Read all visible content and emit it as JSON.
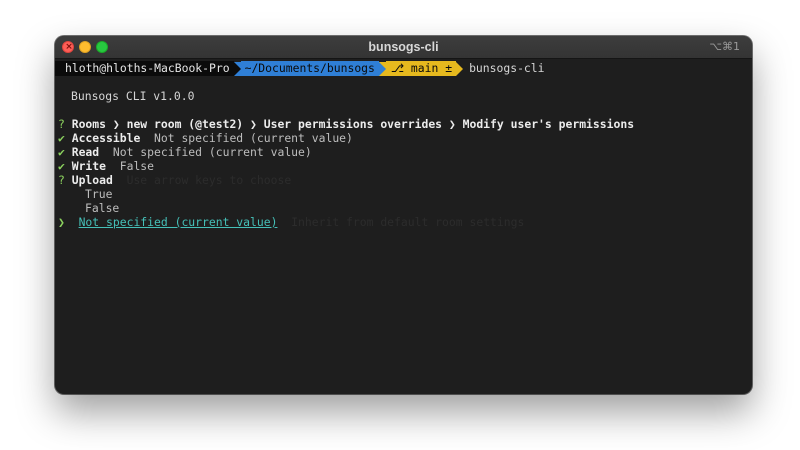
{
  "window": {
    "title": "bunsogs-cli",
    "shortcut": "⌥⌘1"
  },
  "prompt": {
    "user_host": "hloth@hloths-MacBook-Pro",
    "directory": "~/Documents/bunsogs",
    "branch_icon": "git-branch-icon",
    "branch": "main ±",
    "command": "bunsogs-cli"
  },
  "banner": "Bunsogs CLI v1.0.0",
  "breadcrumb": {
    "marker": "?",
    "text": "Rooms ❯ new room (@test2) ❯ User permissions overrides ❯ Modify user's permissions"
  },
  "answered": [
    {
      "mark": "✔",
      "label": "Accessible",
      "value": "Not specified (current value)"
    },
    {
      "mark": "✔",
      "label": "Read",
      "value": "Not specified (current value)"
    },
    {
      "mark": "✔",
      "label": "Write",
      "value": "False"
    }
  ],
  "question": {
    "marker": "?",
    "label": "Upload",
    "hint": "Use arrow keys to choose"
  },
  "options": [
    {
      "label": "True"
    },
    {
      "label": "False"
    },
    {
      "label": "Not specified (current value)",
      "selected": true,
      "pointer": "❯",
      "hint": "Inherit from default room settings"
    }
  ],
  "colors": {
    "prompt_user_bg": "#0b0b0b",
    "prompt_dir_bg": "#2f7fd6",
    "prompt_git_bg": "#e6b91e",
    "check": "#8dd35f",
    "selected": "#45c0b8",
    "terminal_bg": "#1e1e1e"
  }
}
